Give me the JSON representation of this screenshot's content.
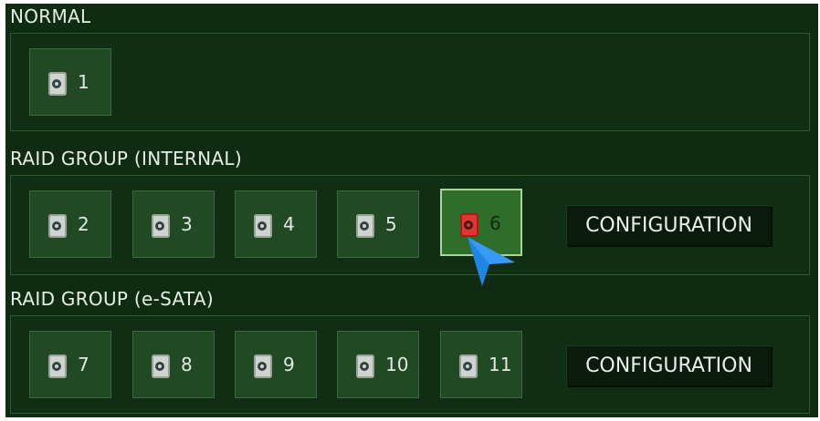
{
  "sections": {
    "normal": {
      "title": "NORMAL",
      "disks": [
        {
          "label": "1",
          "status": "normal"
        }
      ]
    },
    "internal": {
      "title": "RAID GROUP (INTERNAL)",
      "disks": [
        {
          "label": "2",
          "status": "normal"
        },
        {
          "label": "3",
          "status": "normal"
        },
        {
          "label": "4",
          "status": "normal"
        },
        {
          "label": "5",
          "status": "normal"
        },
        {
          "label": "6",
          "status": "error",
          "selected": true
        }
      ],
      "config_label": "CONFIGURATION"
    },
    "esata": {
      "title": "RAID GROUP (e-SATA)",
      "disks": [
        {
          "label": "7",
          "status": "normal"
        },
        {
          "label": "8",
          "status": "normal"
        },
        {
          "label": "9",
          "status": "normal"
        },
        {
          "label": "10",
          "status": "normal"
        },
        {
          "label": "11",
          "status": "normal"
        }
      ],
      "config_label": "CONFIGURATION"
    }
  },
  "colors": {
    "background": "#0f2c12",
    "panel_border": "#2f5a30",
    "button": "#214a24",
    "selected_button": "#2f6d2a",
    "error_disk": "#e03530",
    "cursor": "#1f86e6"
  }
}
